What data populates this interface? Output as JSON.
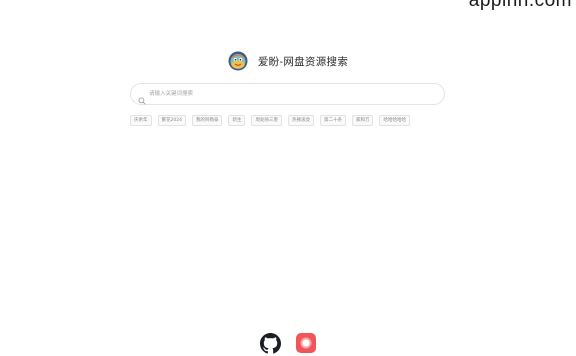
{
  "watermark": "appinn.com",
  "header": {
    "title": "爱盼-网盘资源搜索",
    "logo_icon": "cartoon-face-logo-icon"
  },
  "search": {
    "placeholder": "请输入关键词搜索",
    "value": ""
  },
  "hot_tags": [
    "庆余年",
    "繁花2024",
    "我的阿勒泰",
    "新生",
    "周处除三害",
    "热辣滚烫",
    "第二十条",
    "家和万",
    "哈哈哈哈哈"
  ],
  "footer": {
    "icons": [
      "github-icon",
      "app-icon"
    ]
  },
  "colors": {
    "app_icon_bg": "#f0555a",
    "tag_border": "#e2e2e2",
    "search_border": "#e4e4e4"
  }
}
